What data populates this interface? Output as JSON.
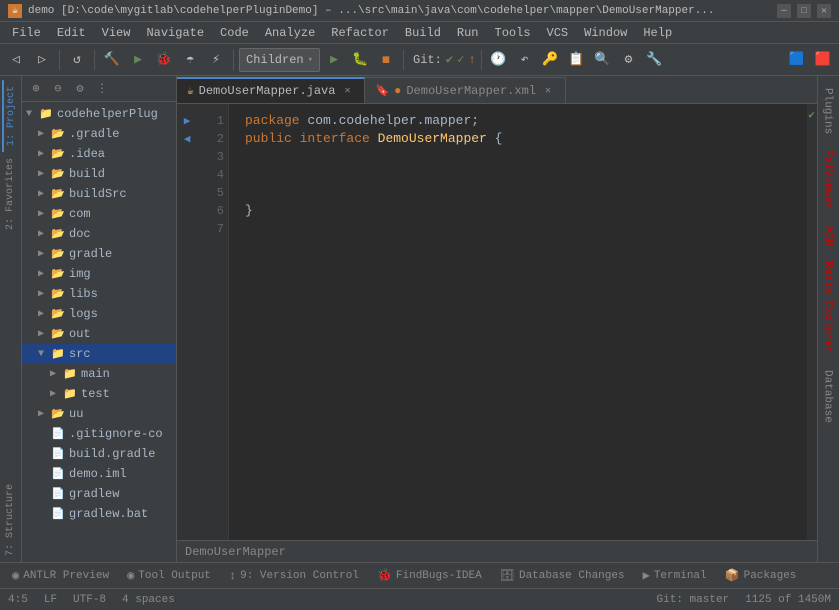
{
  "titlebar": {
    "icon": "☕",
    "text": "demo [D:\\code\\mygitlab\\codehelperPluginDemo] – ...\\src\\main\\java\\com\\codehelper\\mapper\\DemoUserMapper...",
    "minimize": "─",
    "maximize": "□",
    "close": "✕"
  },
  "menubar": {
    "items": [
      "File",
      "Edit",
      "View",
      "Navigate",
      "Code",
      "Analyze",
      "Refactor",
      "Build",
      "Run",
      "Tools",
      "VCS",
      "Window",
      "Help"
    ]
  },
  "toolbar": {
    "dropdown_label": "Children",
    "git_label": "Git:",
    "buttons": [
      "⬅",
      "⏩",
      "🔄",
      "◀",
      "▶",
      "📂",
      "💾",
      "🔍",
      "⚙"
    ]
  },
  "sidebar": {
    "project_label": "1: Project",
    "root": "codehelperPlug",
    "items": [
      {
        "indent": 1,
        "label": ".gradle",
        "type": "folder",
        "expanded": false
      },
      {
        "indent": 1,
        "label": ".idea",
        "type": "folder",
        "expanded": false
      },
      {
        "indent": 1,
        "label": "build",
        "type": "folder",
        "expanded": false
      },
      {
        "indent": 1,
        "label": "buildSrc",
        "type": "folder",
        "expanded": false
      },
      {
        "indent": 1,
        "label": "com",
        "type": "folder",
        "expanded": false
      },
      {
        "indent": 1,
        "label": "doc",
        "type": "folder",
        "expanded": false
      },
      {
        "indent": 1,
        "label": "gradle",
        "type": "folder",
        "expanded": false
      },
      {
        "indent": 1,
        "label": "img",
        "type": "folder",
        "expanded": false
      },
      {
        "indent": 1,
        "label": "libs",
        "type": "folder",
        "expanded": false
      },
      {
        "indent": 1,
        "label": "logs",
        "type": "folder",
        "expanded": false
      },
      {
        "indent": 1,
        "label": "out",
        "type": "folder",
        "expanded": false,
        "color": "orange"
      },
      {
        "indent": 1,
        "label": "src",
        "type": "folder",
        "expanded": true,
        "color": "blue"
      },
      {
        "indent": 2,
        "label": "main",
        "type": "folder",
        "expanded": false,
        "color": "blue"
      },
      {
        "indent": 2,
        "label": "test",
        "type": "folder",
        "expanded": false,
        "color": "blue"
      },
      {
        "indent": 1,
        "label": "uu",
        "type": "folder",
        "expanded": false
      },
      {
        "indent": 1,
        "label": ".gitignore-co",
        "type": "file"
      },
      {
        "indent": 1,
        "label": "build.gradle",
        "type": "file"
      },
      {
        "indent": 1,
        "label": "demo.iml",
        "type": "file"
      },
      {
        "indent": 1,
        "label": "gradlew",
        "type": "file"
      },
      {
        "indent": 1,
        "label": "gradlew.bat",
        "type": "file"
      }
    ]
  },
  "left_vtabs": [
    "2: Favorites",
    "7: Structure"
  ],
  "editor": {
    "tabs": [
      {
        "label": "DemoUserMapper.java",
        "active": true,
        "modified": false
      },
      {
        "label": "DemoUserMapper.xml",
        "active": false,
        "modified": true
      }
    ],
    "lines": [
      {
        "num": 1,
        "text": "package com.codehelper.mapper;"
      },
      {
        "num": 2,
        "text": "public interface DemoUserMapper {"
      },
      {
        "num": 3,
        "text": ""
      },
      {
        "num": 4,
        "text": ""
      },
      {
        "num": 5,
        "text": ""
      },
      {
        "num": 6,
        "text": "}"
      },
      {
        "num": 7,
        "text": ""
      }
    ],
    "filename_bar": "DemoUserMapper"
  },
  "right_vtabs": [
    "Plugins",
    "PsiViewer",
    "ASM",
    "Redis Explorer",
    "Database"
  ],
  "bottom_tabs": [
    {
      "label": "ANTLR Preview",
      "icon": "◉"
    },
    {
      "label": "Tool Output",
      "icon": "◉"
    },
    {
      "label": "9: Version Control",
      "icon": "↕"
    },
    {
      "label": "FindBugs-IDEA",
      "icon": "🐞"
    },
    {
      "label": "Database Changes",
      "icon": "🗃"
    },
    {
      "label": "Terminal",
      "icon": "▶"
    },
    {
      "label": "Packages",
      "icon": "📦"
    }
  ],
  "statusbar": {
    "position": "4:5",
    "line_ending": "LF",
    "encoding": "UTF-8",
    "indent": "4 spaces",
    "git": "Git: master",
    "memory": "1125 of 1450M"
  }
}
